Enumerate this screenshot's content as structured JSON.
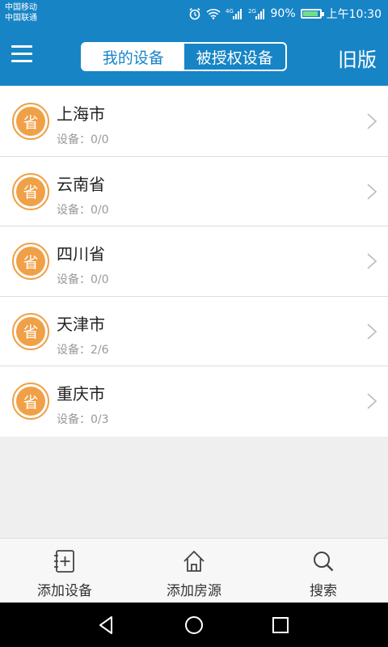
{
  "status_bar": {
    "carrier_1": "中国移动",
    "carrier_2": "中国联通",
    "signal_1": "4G",
    "signal_2": "2G",
    "battery": "90%",
    "battery_level": 0.9,
    "time": "上午10:30"
  },
  "header": {
    "tabs": [
      {
        "label": "我的设备",
        "active": true
      },
      {
        "label": "被授权设备",
        "active": false
      }
    ],
    "old_version": "旧版"
  },
  "list": {
    "items": [
      {
        "badge": "省",
        "name": "上海市",
        "devices": "设备：0/0"
      },
      {
        "badge": "省",
        "name": "云南省",
        "devices": "设备：0/0"
      },
      {
        "badge": "省",
        "name": "四川省",
        "devices": "设备：0/0"
      },
      {
        "badge": "省",
        "name": "天津市",
        "devices": "设备：2/6"
      },
      {
        "badge": "省",
        "name": "重庆市",
        "devices": "设备：0/3"
      }
    ]
  },
  "bottom_tabs": [
    {
      "label": "添加设备",
      "icon": "add-note-icon"
    },
    {
      "label": "添加房源",
      "icon": "house-icon"
    },
    {
      "label": "搜索",
      "icon": "search-icon"
    }
  ],
  "colors": {
    "primary": "#1784c6",
    "badge": "#f0a046",
    "background": "#efeff0"
  }
}
